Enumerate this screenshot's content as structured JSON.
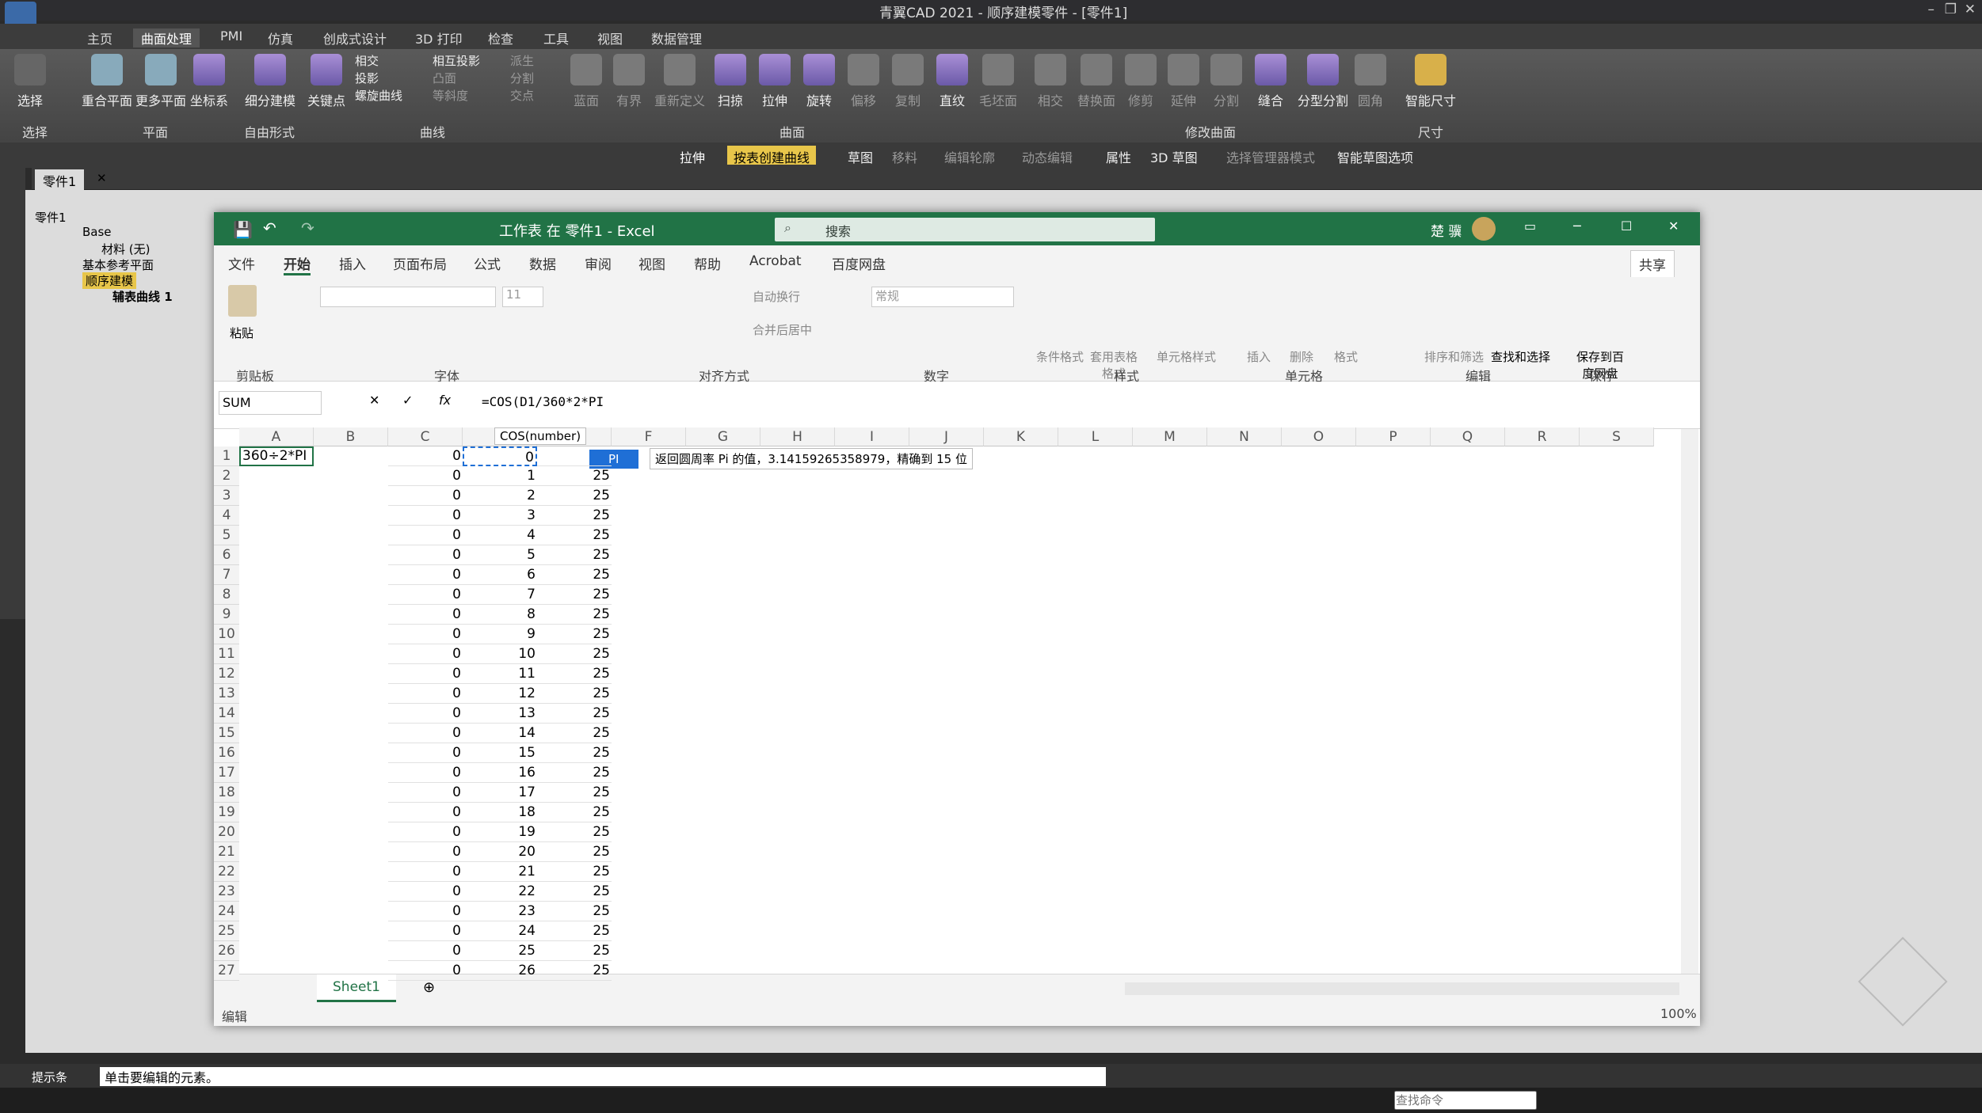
{
  "cad": {
    "title": "青翼CAD 2021 - 顺序建模零件 - [零件1]",
    "tabs": [
      "主页",
      "曲面处理",
      "PMI",
      "仿真",
      "创成式设计",
      "3D 打印",
      "检查",
      "工具",
      "视图",
      "数据管理"
    ],
    "ribbon": {
      "select_label": "选择",
      "buttons": [
        {
          "label": "选择",
          "group": "选择"
        },
        {
          "label": "重合平面",
          "group": "平面"
        },
        {
          "label": "更多平面",
          "group": "平面"
        },
        {
          "label": "坐标系",
          "group": "平面"
        },
        {
          "label": "细分建模",
          "group": "自由形式"
        },
        {
          "label": "关键点",
          "group": "曲线"
        },
        {
          "label": "相交",
          "group": "曲线"
        },
        {
          "label": "投影",
          "group": "曲线"
        },
        {
          "label": "螺旋曲线",
          "group": "曲线"
        },
        {
          "label": "相互投影",
          "group": "曲线"
        },
        {
          "label": "凸面",
          "group": "曲线"
        },
        {
          "label": "等斜度",
          "group": "曲线"
        },
        {
          "label": "派生",
          "group": "曲线"
        },
        {
          "label": "分割",
          "group": "曲线"
        },
        {
          "label": "交点",
          "group": "曲线"
        },
        {
          "label": "蓝面",
          "group": "曲面"
        },
        {
          "label": "有界",
          "group": "曲面"
        },
        {
          "label": "重新定义",
          "group": "曲面"
        },
        {
          "label": "扫掠",
          "group": "曲面"
        },
        {
          "label": "拉伸",
          "group": "曲面"
        },
        {
          "label": "旋转",
          "group": "曲面"
        },
        {
          "label": "偏移",
          "group": "曲面"
        },
        {
          "label": "复制",
          "group": "曲面"
        },
        {
          "label": "直纹",
          "group": "曲面"
        },
        {
          "label": "毛坯面",
          "group": "曲面"
        },
        {
          "label": "相交",
          "group": "修改曲面"
        },
        {
          "label": "替换面",
          "group": "修改曲面"
        },
        {
          "label": "修剪",
          "group": "修改曲面"
        },
        {
          "label": "延伸",
          "group": "修改曲面"
        },
        {
          "label": "分割",
          "group": "修改曲面"
        },
        {
          "label": "缝合",
          "group": "修改曲面"
        },
        {
          "label": "分型分割",
          "group": "修改曲面"
        },
        {
          "label": "圆角",
          "group": "修改曲面"
        },
        {
          "label": "智能尺寸",
          "group": "尺寸"
        }
      ],
      "groups": [
        "选择",
        "平面",
        "自由形式",
        "曲线",
        "曲面",
        "修改曲面",
        "尺寸"
      ]
    },
    "toolbar2": [
      "拉伸",
      "按表创建曲线",
      "草图",
      "移料",
      "编辑轮廓",
      "动态编辑",
      "属性",
      "3D 草图",
      "选择管理器模式",
      "智能草图选项"
    ],
    "doc_tab": "零件1",
    "tree": [
      {
        "label": "零件1",
        "level": 0
      },
      {
        "label": "Base",
        "level": 1
      },
      {
        "label": "材料 (无)",
        "level": 2
      },
      {
        "label": "基本参考平面",
        "level": 1
      },
      {
        "label": "顺序建模",
        "level": 1
      },
      {
        "label": "辅表曲线 1",
        "level": 2
      }
    ],
    "status_label": "提示条",
    "status_text": "单击要编辑的元素。",
    "search_placeholder": "查找命令"
  },
  "excel": {
    "title": "工作表 在 零件1 - Excel",
    "search_placeholder": "搜索",
    "user": "楚 骥",
    "menu": [
      "文件",
      "开始",
      "插入",
      "页面布局",
      "公式",
      "数据",
      "审阅",
      "视图",
      "帮助",
      "Acrobat",
      "百度网盘"
    ],
    "active_menu": "开始",
    "share": "共享",
    "ribbon_groups": [
      "剪贴板",
      "字体",
      "对齐方式",
      "数字",
      "样式",
      "单元格",
      "编辑",
      "保存"
    ],
    "ribbon_labels": {
      "paste": "粘贴",
      "wrap": "自动换行",
      "merge": "合并后居中",
      "number_format": "常规",
      "cond_format": "条件格式",
      "table_format": "套用表格格式",
      "cell_style": "单元格样式",
      "insert": "插入",
      "delete": "删除",
      "format": "格式",
      "sort": "排序和筛选",
      "find": "查找和选择",
      "save_baidu": "保存到百度网盘",
      "font_size": "11"
    },
    "name_box": "SUM",
    "formula": "=COS(D1/360*2*PI",
    "tooltip_func": "COS(number)",
    "autocomplete": "PI",
    "autocomplete_desc": "返回圆周率 Pi 的值，3.14159265358979，精确到 15 位",
    "columns": [
      "A",
      "B",
      "C",
      "D",
      "E",
      "F",
      "G",
      "H",
      "I",
      "J",
      "K",
      "L",
      "M",
      "N",
      "O",
      "P",
      "Q",
      "R",
      "S"
    ],
    "a1": "360÷2*PI",
    "rows": [
      {
        "n": "1",
        "c": "0",
        "d": "0",
        "e": ""
      },
      {
        "n": "2",
        "c": "0",
        "d": "1",
        "e": "25"
      },
      {
        "n": "3",
        "c": "0",
        "d": "2",
        "e": "25"
      },
      {
        "n": "4",
        "c": "0",
        "d": "3",
        "e": "25"
      },
      {
        "n": "5",
        "c": "0",
        "d": "4",
        "e": "25"
      },
      {
        "n": "6",
        "c": "0",
        "d": "5",
        "e": "25"
      },
      {
        "n": "7",
        "c": "0",
        "d": "6",
        "e": "25"
      },
      {
        "n": "8",
        "c": "0",
        "d": "7",
        "e": "25"
      },
      {
        "n": "9",
        "c": "0",
        "d": "8",
        "e": "25"
      },
      {
        "n": "10",
        "c": "0",
        "d": "9",
        "e": "25"
      },
      {
        "n": "11",
        "c": "0",
        "d": "10",
        "e": "25"
      },
      {
        "n": "12",
        "c": "0",
        "d": "11",
        "e": "25"
      },
      {
        "n": "13",
        "c": "0",
        "d": "12",
        "e": "25"
      },
      {
        "n": "14",
        "c": "0",
        "d": "13",
        "e": "25"
      },
      {
        "n": "15",
        "c": "0",
        "d": "14",
        "e": "25"
      },
      {
        "n": "16",
        "c": "0",
        "d": "15",
        "e": "25"
      },
      {
        "n": "17",
        "c": "0",
        "d": "16",
        "e": "25"
      },
      {
        "n": "18",
        "c": "0",
        "d": "17",
        "e": "25"
      },
      {
        "n": "19",
        "c": "0",
        "d": "18",
        "e": "25"
      },
      {
        "n": "20",
        "c": "0",
        "d": "19",
        "e": "25"
      },
      {
        "n": "21",
        "c": "0",
        "d": "20",
        "e": "25"
      },
      {
        "n": "22",
        "c": "0",
        "d": "21",
        "e": "25"
      },
      {
        "n": "23",
        "c": "0",
        "d": "22",
        "e": "25"
      },
      {
        "n": "24",
        "c": "0",
        "d": "23",
        "e": "25"
      },
      {
        "n": "25",
        "c": "0",
        "d": "24",
        "e": "25"
      },
      {
        "n": "26",
        "c": "0",
        "d": "25",
        "e": "25"
      },
      {
        "n": "27",
        "c": "0",
        "d": "26",
        "e": "25"
      }
    ],
    "sheet_tab": "Sheet1",
    "status_mode": "编辑",
    "zoom": "100%"
  }
}
